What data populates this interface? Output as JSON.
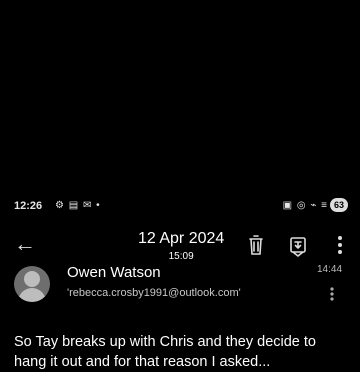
{
  "status_bar": {
    "time": "12:26",
    "left_icons": "⚙ ▤ ✉ •",
    "right_icons": "▣ ◎ ⌁ ≡",
    "battery_label": "63"
  },
  "toolbar": {
    "back_icon": "←",
    "date": "12 Apr 2024",
    "time": "15:09"
  },
  "message": {
    "sender_name": "Owen Watson",
    "recipient_email": "'rebecca.crosby1991@outlook.com'",
    "received_time": "14:44",
    "body_line1": "So Tay breaks up with Chris and they decide to",
    "body_line2": "hang it out and for that reason I asked..."
  }
}
